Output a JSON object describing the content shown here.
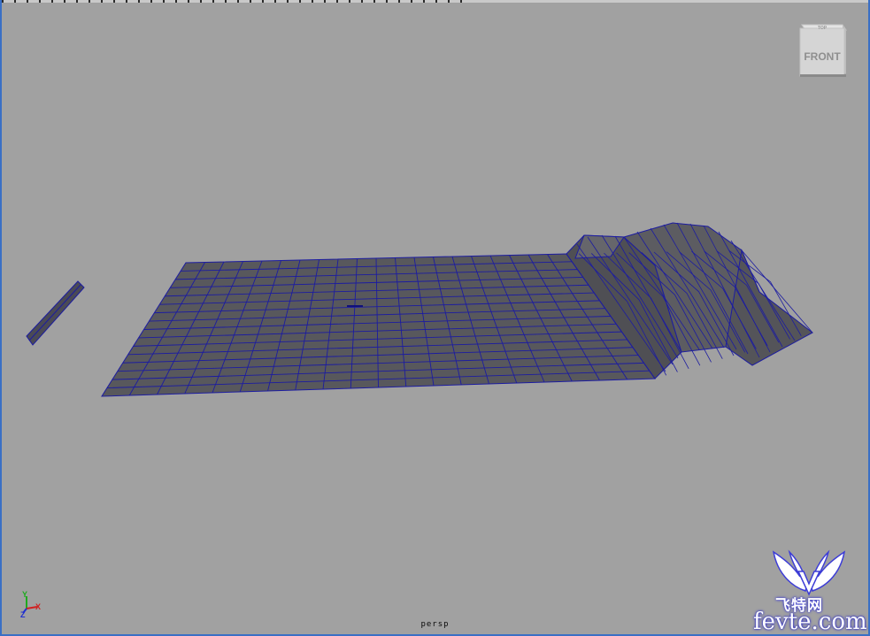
{
  "viewport": {
    "camera_label": "persp",
    "background": "#a1a1a1",
    "wire_color": "#1c1ca0",
    "surface_color": "#58585c"
  },
  "viewcube": {
    "top_label": "TOP",
    "front_label": "FRONT"
  },
  "axis_indicator": {
    "y_label": "Y",
    "x_label": "X",
    "z_label": "Z"
  },
  "watermark": {
    "chinese_text": "飞特网",
    "domain_text": "fevte.com"
  }
}
